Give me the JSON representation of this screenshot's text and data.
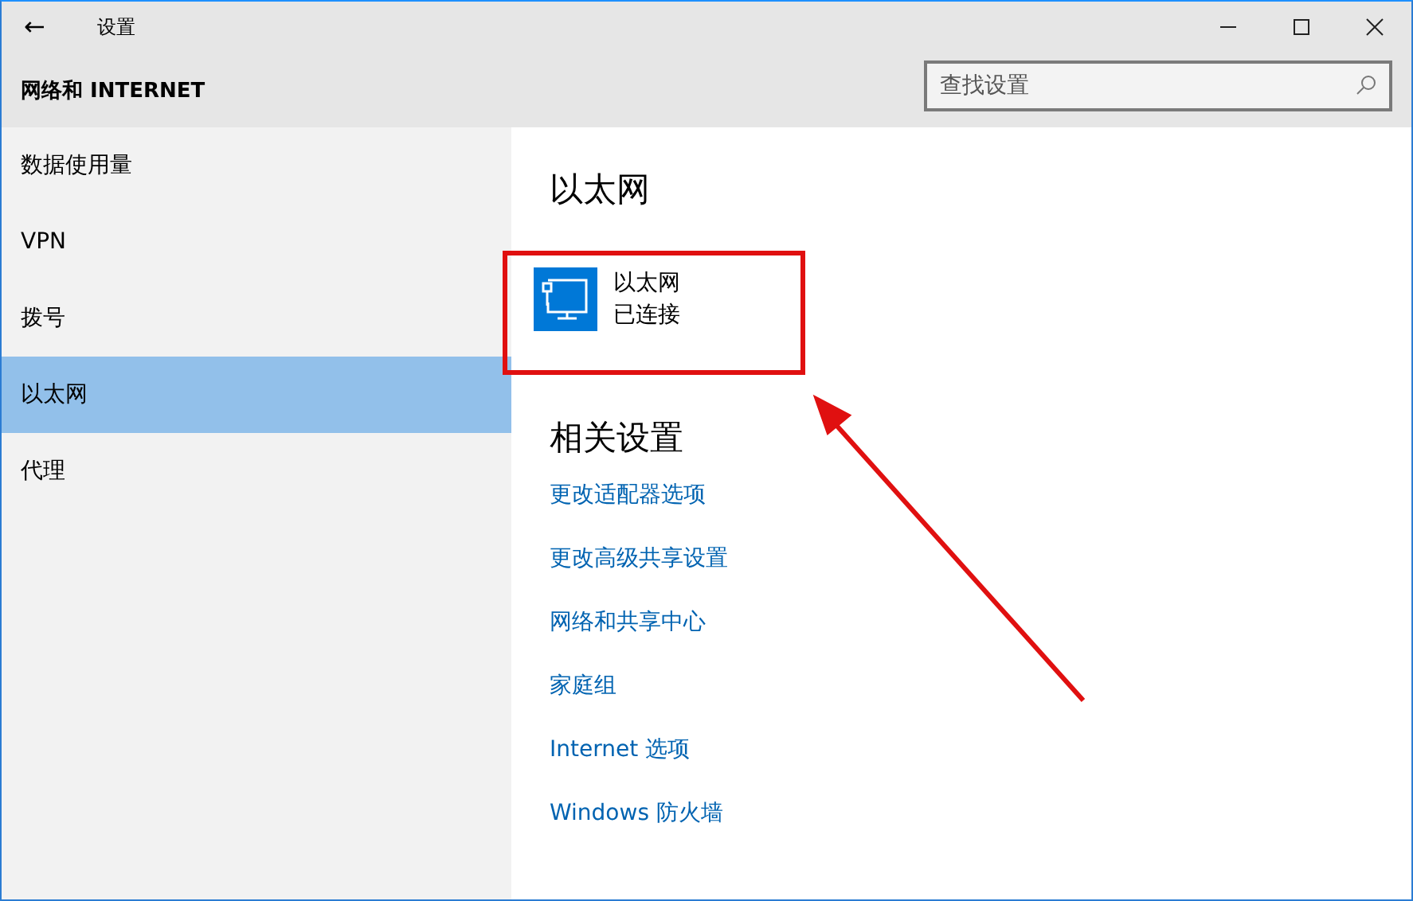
{
  "window": {
    "title": "设置",
    "back_button": "←"
  },
  "header": {
    "title": "网络和 INTERNET"
  },
  "search": {
    "placeholder": "查找设置"
  },
  "sidebar": {
    "items": [
      {
        "label": "数据使用量",
        "selected": false
      },
      {
        "label": "VPN",
        "selected": false
      },
      {
        "label": "拨号",
        "selected": false
      },
      {
        "label": "以太网",
        "selected": true
      },
      {
        "label": "代理",
        "selected": false
      }
    ]
  },
  "content": {
    "title": "以太网",
    "connection": {
      "name": "以太网",
      "status": "已连接"
    },
    "related_title": "相关设置",
    "links": [
      "更改适配器选项",
      "更改高级共享设置",
      "网络和共享中心",
      "家庭组",
      "Internet 选项",
      "Windows 防火墙"
    ]
  }
}
